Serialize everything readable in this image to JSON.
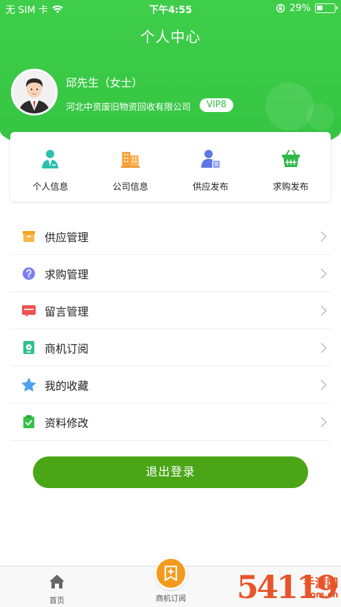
{
  "status_bar": {
    "carrier": "无 SIM 卡",
    "time": "下午4:55",
    "battery": "29%"
  },
  "header": {
    "title": "个人中心"
  },
  "profile": {
    "name": "邱先生（女士）",
    "company": "河北中资废旧物资回收有限公司",
    "vip": "VIP8"
  },
  "quick_actions": [
    {
      "label": "个人信息",
      "icon": "user-icon"
    },
    {
      "label": "公司信息",
      "icon": "building-icon"
    },
    {
      "label": "供应发布",
      "icon": "supply-publish-icon"
    },
    {
      "label": "求购发布",
      "icon": "basket-icon"
    }
  ],
  "menu": [
    {
      "label": "供应管理",
      "icon": "box-icon",
      "color": "#f5a623"
    },
    {
      "label": "求购管理",
      "icon": "question-icon",
      "color": "#7b7ff0"
    },
    {
      "label": "留言管理",
      "icon": "message-icon",
      "color": "#ef5350"
    },
    {
      "label": "商机订阅",
      "icon": "subscribe-icon",
      "color": "#2fc08f"
    },
    {
      "label": "我的收藏",
      "icon": "star-icon",
      "color": "#4aa3f0"
    },
    {
      "label": "资料修改",
      "icon": "clipboard-check-icon",
      "color": "#35c24a"
    }
  ],
  "logout_label": "退出登录",
  "tabbar": {
    "home": "首页",
    "subscribe": "商机订阅"
  },
  "watermark": {
    "big": "54119",
    "small": "手游网",
    "url": ".com.cn"
  },
  "colors": {
    "primary_green": "#35c442",
    "logout_green": "#4aa617",
    "accent_orange": "#f39a1d"
  }
}
